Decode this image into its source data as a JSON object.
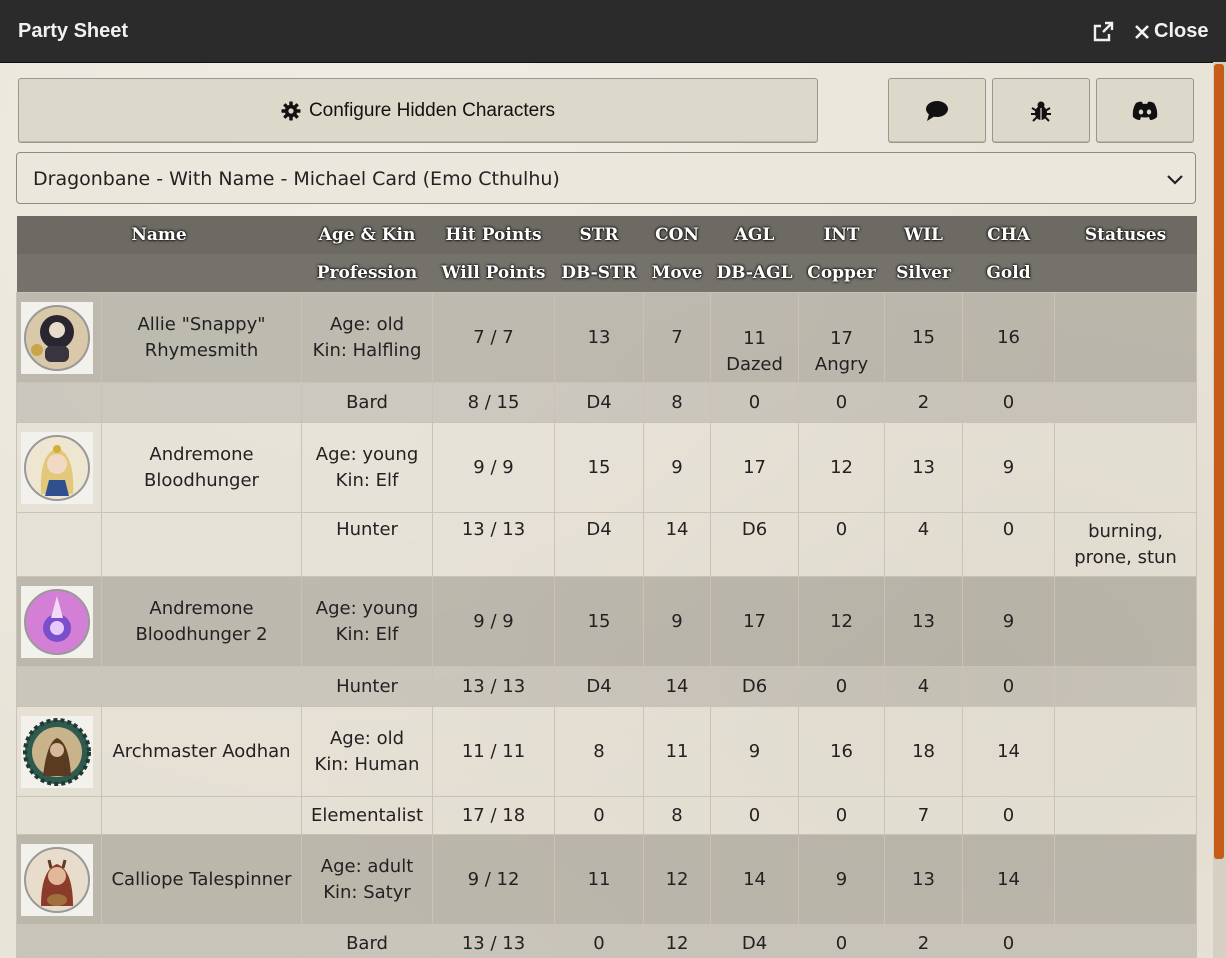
{
  "window": {
    "title": "Party Sheet",
    "close_label": "Close"
  },
  "toolbar": {
    "configure_label": "Configure Hidden Characters"
  },
  "selector": {
    "value": "Dragonbane - With Name - Michael Card (Emo Cthulhu)"
  },
  "table": {
    "headers_row1": [
      "Name",
      "Age & Kin",
      "Hit Points",
      "STR",
      "CON",
      "AGL",
      "INT",
      "WIL",
      "CHA",
      "Statuses"
    ],
    "headers_row2": [
      "",
      "Profession",
      "Will Points",
      "DB-STR",
      "Move",
      "DB-AGL",
      "Copper",
      "Silver",
      "Gold",
      ""
    ],
    "characters": [
      {
        "name": "Allie \"Snappy\" Rhymesmith",
        "age": "Age: old",
        "kin": "Kin: Halfling",
        "hp": "7 / 7",
        "str": "13",
        "con": "7",
        "agl": "11",
        "agl_status": "Dazed",
        "int": "17",
        "int_status": "Angry",
        "wil": "15",
        "cha": "16",
        "profession": "Bard",
        "wp": "8 / 15",
        "db_str": "D4",
        "move": "8",
        "db_agl": "0",
        "copper": "0",
        "silver": "2",
        "gold": "0",
        "statuses": ""
      },
      {
        "name": "Andremone Bloodhunger",
        "age": "Age: young",
        "kin": "Kin: Elf",
        "hp": "9 / 9",
        "str": "15",
        "con": "9",
        "agl": "17",
        "agl_status": "",
        "int": "12",
        "int_status": "",
        "wil": "13",
        "cha": "9",
        "profession": "Hunter",
        "wp": "13 / 13",
        "db_str": "D4",
        "move": "14",
        "db_agl": "D6",
        "copper": "0",
        "silver": "4",
        "gold": "0",
        "statuses": "burning, prone, stun"
      },
      {
        "name": "Andremone Bloodhunger 2",
        "age": "Age: young",
        "kin": "Kin: Elf",
        "hp": "9 / 9",
        "str": "15",
        "con": "9",
        "agl": "17",
        "agl_status": "",
        "int": "12",
        "int_status": "",
        "wil": "13",
        "cha": "9",
        "profession": "Hunter",
        "wp": "13 / 13",
        "db_str": "D4",
        "move": "14",
        "db_agl": "D6",
        "copper": "0",
        "silver": "4",
        "gold": "0",
        "statuses": ""
      },
      {
        "name": "Archmaster Aodhan",
        "age": "Age: old",
        "kin": "Kin: Human",
        "hp": "11 / 11",
        "str": "8",
        "con": "11",
        "agl": "9",
        "agl_status": "",
        "int": "16",
        "int_status": "",
        "wil": "18",
        "cha": "14",
        "profession": "Elementalist",
        "wp": "17 / 18",
        "db_str": "0",
        "move": "8",
        "db_agl": "0",
        "copper": "0",
        "silver": "7",
        "gold": "0",
        "statuses": ""
      },
      {
        "name": "Calliope Talespinner",
        "age": "Age: adult",
        "kin": "Kin: Satyr",
        "hp": "9 / 12",
        "str": "11",
        "con": "12",
        "agl": "14",
        "agl_status": "",
        "int": "9",
        "int_status": "",
        "wil": "13",
        "cha": "14",
        "profession": "Bard",
        "wp": "13 / 13",
        "db_str": "0",
        "move": "12",
        "db_agl": "D4",
        "copper": "0",
        "silver": "2",
        "gold": "0",
        "statuses": ""
      }
    ]
  },
  "icons": {
    "popout": "external-link-icon",
    "close": "close-icon",
    "configure": "gear-icon",
    "chat": "chat-bubble-icon",
    "bug": "bug-icon",
    "discord": "discord-icon",
    "dropdown": "chevron-down-icon"
  },
  "colors": {
    "titlebar": "#2b2b2b",
    "scroll_thumb": "#c65c18",
    "header_bg": "#6d6a63"
  }
}
